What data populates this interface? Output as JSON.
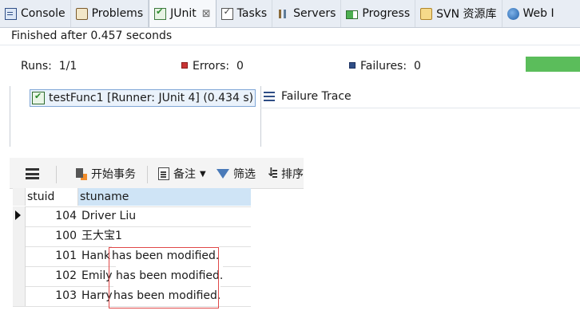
{
  "eclipse": {
    "tabs": [
      {
        "label": "Console",
        "icon": "console-icon",
        "active": false
      },
      {
        "label": "Problems",
        "icon": "problems-icon",
        "active": false
      },
      {
        "label": "JUnit",
        "icon": "junit-icon",
        "active": true,
        "close": "⊠"
      },
      {
        "label": "Tasks",
        "icon": "tasks-icon",
        "active": false
      },
      {
        "label": "Servers",
        "icon": "servers-icon",
        "active": false
      },
      {
        "label": "Progress",
        "icon": "progress-icon",
        "active": false
      },
      {
        "label": "SVN 资源库",
        "icon": "svn-repository-icon",
        "active": false
      },
      {
        "label": "Web I",
        "icon": "web-icon",
        "active": false
      }
    ],
    "status": "Finished after 0.457 seconds",
    "runs_label": "Runs:",
    "runs_value": "1/1",
    "errors_label": "Errors:",
    "errors_value": "0",
    "failures_label": "Failures:",
    "failures_value": "0",
    "progress_fraction": 1.0,
    "progress_color": "#5bbd5b",
    "test_node": "testFunc1 [Runner: JUnit 4] (0.434 s)",
    "failure_trace": "Failure Trace"
  },
  "db": {
    "toolbar": {
      "begin_transaction": "开始事务",
      "note": "备注",
      "filter": "筛选",
      "sort": "排序"
    },
    "columns": [
      "stuid",
      "stuname"
    ],
    "rows": [
      {
        "stuid": "104",
        "stuname": "Driver Liu"
      },
      {
        "stuid": "100",
        "stuname": "王大宝1"
      },
      {
        "stuid": "101",
        "stuname": "Hank"
      },
      {
        "stuid": "102",
        "stuname": "Emily"
      },
      {
        "stuid": "103",
        "stuname": "Harry"
      }
    ],
    "modified_text": [
      "has been modified.",
      "has been modified.",
      "has been modified."
    ],
    "highlight_color": "#e04848",
    "header_color": "#cfe4f6"
  }
}
